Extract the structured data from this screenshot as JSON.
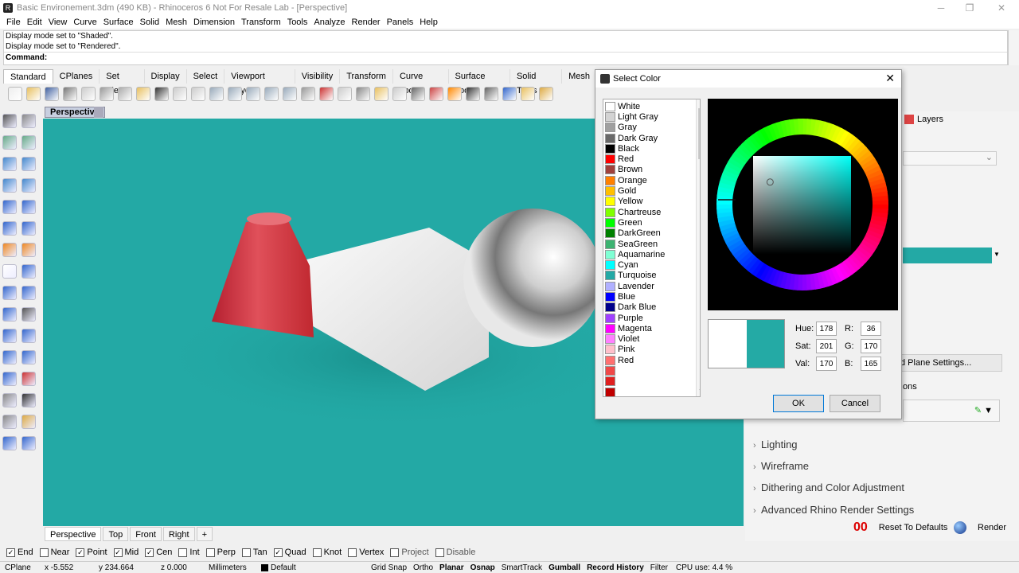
{
  "window": {
    "title": "Basic Environement.3dm (490 KB) - Rhinoceros 6 Not For Resale Lab - [Perspective]"
  },
  "menu": [
    "File",
    "Edit",
    "View",
    "Curve",
    "Surface",
    "Solid",
    "Mesh",
    "Dimension",
    "Transform",
    "Tools",
    "Analyze",
    "Render",
    "Panels",
    "Help"
  ],
  "command_history": [
    "Display mode set to \"Shaded\".",
    "Display mode set to \"Rendered\"."
  ],
  "command_label": "Command:",
  "toolbar_tabs": [
    "Standard",
    "CPlanes",
    "Set View",
    "Display",
    "Select",
    "Viewport Layout",
    "Visibility",
    "Transform",
    "Curve Tools",
    "Surface Tools",
    "Solid Tools",
    "Mesh"
  ],
  "viewport": {
    "label": "Perspective",
    "background": "#23a9a5"
  },
  "viewport_tabs": [
    "Perspective",
    "Top",
    "Front",
    "Right"
  ],
  "osnaps": [
    {
      "label": "End",
      "checked": true
    },
    {
      "label": "Near",
      "checked": false
    },
    {
      "label": "Point",
      "checked": true
    },
    {
      "label": "Mid",
      "checked": true
    },
    {
      "label": "Cen",
      "checked": true
    },
    {
      "label": "Int",
      "checked": false
    },
    {
      "label": "Perp",
      "checked": false
    },
    {
      "label": "Tan",
      "checked": false
    },
    {
      "label": "Quad",
      "checked": true
    },
    {
      "label": "Knot",
      "checked": false
    },
    {
      "label": "Vertex",
      "checked": false
    },
    {
      "label": "Project",
      "checked": false
    },
    {
      "label": "Disable",
      "checked": false
    }
  ],
  "status": {
    "cplane": "CPlane",
    "x": "x -5.552",
    "y": "y 234.664",
    "z": "z 0.000",
    "units": "Millimeters",
    "layer": "Default",
    "toggles": [
      {
        "t": "Grid Snap",
        "b": false
      },
      {
        "t": "Ortho",
        "b": false
      },
      {
        "t": "Planar",
        "b": true
      },
      {
        "t": "Osnap",
        "b": true
      },
      {
        "t": "SmartTrack",
        "b": false
      },
      {
        "t": "Gumball",
        "b": true
      },
      {
        "t": "Record History",
        "b": true
      },
      {
        "t": "Filter",
        "b": false
      }
    ],
    "cpu": "CPU use: 4.4 %"
  },
  "right_panel": {
    "layers_tab": "Layers",
    "ground_plane_button": "d Plane Settings...",
    "partial_label": "ons",
    "sections": [
      "Lighting",
      "Wireframe",
      "Dithering and Color Adjustment",
      "Advanced Rhino Render Settings"
    ],
    "reset_button": "Reset To Defaults",
    "render_button": "Render",
    "accent_color": "#23a9a5"
  },
  "dialog": {
    "title": "Select Color",
    "colors": [
      {
        "name": "White",
        "hex": "#ffffff"
      },
      {
        "name": "Light Gray",
        "hex": "#d3d3d3"
      },
      {
        "name": "Gray",
        "hex": "#a0a0a0"
      },
      {
        "name": "Dark Gray",
        "hex": "#696969"
      },
      {
        "name": "Black",
        "hex": "#000000"
      },
      {
        "name": "Red",
        "hex": "#ff0000"
      },
      {
        "name": "Brown",
        "hex": "#a0413c"
      },
      {
        "name": "Orange",
        "hex": "#ff8000"
      },
      {
        "name": "Gold",
        "hex": "#ffbf00"
      },
      {
        "name": "Yellow",
        "hex": "#ffff00"
      },
      {
        "name": "Chartreuse",
        "hex": "#80ff00"
      },
      {
        "name": "Green",
        "hex": "#00ff00"
      },
      {
        "name": "DarkGreen",
        "hex": "#008000"
      },
      {
        "name": "SeaGreen",
        "hex": "#3cb371"
      },
      {
        "name": "Aquamarine",
        "hex": "#7fffd4"
      },
      {
        "name": "Cyan",
        "hex": "#00ffff"
      },
      {
        "name": "Turquoise",
        "hex": "#23a9a5"
      },
      {
        "name": "Lavender",
        "hex": "#b0b0ff"
      },
      {
        "name": "Blue",
        "hex": "#0000ff"
      },
      {
        "name": "Dark Blue",
        "hex": "#00008b"
      },
      {
        "name": "Purple",
        "hex": "#a040ff"
      },
      {
        "name": "Magenta",
        "hex": "#ff00ff"
      },
      {
        "name": "Violet",
        "hex": "#ff80ff"
      },
      {
        "name": "Pink",
        "hex": "#ffc0cb"
      },
      {
        "name": "Red",
        "hex": "#ff7070"
      },
      {
        "name": "",
        "hex": "#f04848"
      },
      {
        "name": "",
        "hex": "#e02020"
      },
      {
        "name": "",
        "hex": "#c00000"
      }
    ],
    "hue_label": "Hue:",
    "hue": "178",
    "sat_label": "Sat:",
    "sat": "201",
    "val_label": "Val:",
    "val": "170",
    "r_label": "R:",
    "r": "36",
    "g_label": "G:",
    "g": "170",
    "b_label": "B:",
    "b": "165",
    "old_color": "#ffffff",
    "new_color": "#24aaa5",
    "ok": "OK",
    "cancel": "Cancel"
  }
}
